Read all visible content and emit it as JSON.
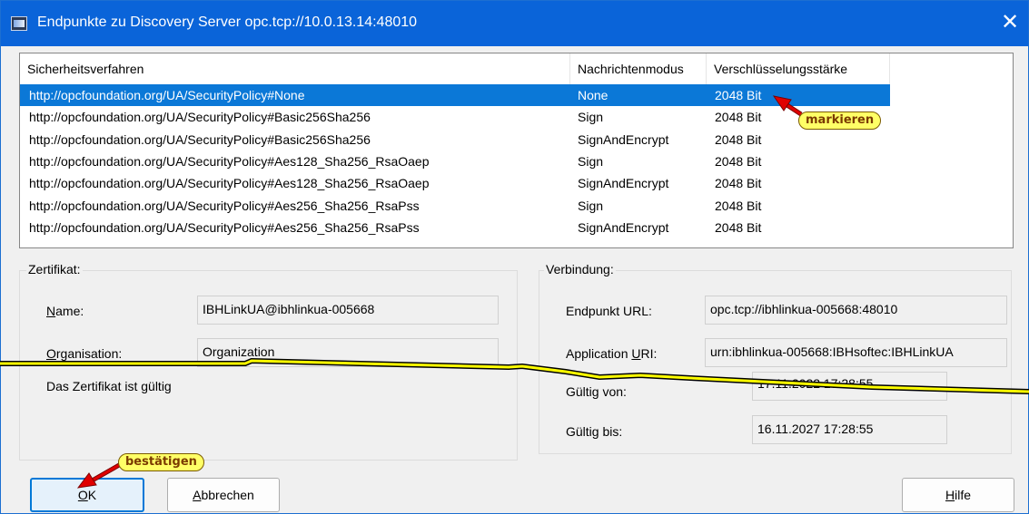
{
  "window": {
    "title": "Endpunkte zu Discovery Server opc.tcp://10.0.13.14:48010",
    "close_symbol": "✕"
  },
  "list": {
    "headers": [
      "Sicherheitsverfahren",
      "Nachrichtenmodus",
      "Verschlüsselungsstärke"
    ],
    "rows": [
      {
        "policy": "http://opcfoundation.org/UA/SecurityPolicy#None",
        "mode": "None",
        "strength": "2048 Bit",
        "selected": true
      },
      {
        "policy": "http://opcfoundation.org/UA/SecurityPolicy#Basic256Sha256",
        "mode": "Sign",
        "strength": "2048 Bit"
      },
      {
        "policy": "http://opcfoundation.org/UA/SecurityPolicy#Basic256Sha256",
        "mode": "SignAndEncrypt",
        "strength": "2048 Bit"
      },
      {
        "policy": "http://opcfoundation.org/UA/SecurityPolicy#Aes128_Sha256_RsaOaep",
        "mode": "Sign",
        "strength": "2048 Bit"
      },
      {
        "policy": "http://opcfoundation.org/UA/SecurityPolicy#Aes128_Sha256_RsaOaep",
        "mode": "SignAndEncrypt",
        "strength": "2048 Bit"
      },
      {
        "policy": "http://opcfoundation.org/UA/SecurityPolicy#Aes256_Sha256_RsaPss",
        "mode": "Sign",
        "strength": "2048 Bit"
      },
      {
        "policy": "http://opcfoundation.org/UA/SecurityPolicy#Aes256_Sha256_RsaPss",
        "mode": "SignAndEncrypt",
        "strength": "2048 Bit"
      }
    ]
  },
  "certificate": {
    "group_label": "Zertifikat:",
    "name_label": {
      "hot": "N",
      "rest": "ame:"
    },
    "name_value": "IBHLinkUA@ibhlinkua-005668",
    "org_label": {
      "hot": "O",
      "rest": "rganisation:"
    },
    "org_value": "Organization",
    "status": "Das Zertifikat ist gültig"
  },
  "connection": {
    "group_label": "Verbindung:",
    "endpoint_label": "Endpunkt URL:",
    "endpoint_value": "opc.tcp://ibhlinkua-005668:48010",
    "app_uri_label": {
      "pre": "Application ",
      "hot": "U",
      "rest": "RI:"
    },
    "app_uri_value": "urn:ibhlinkua-005668:IBHsoftec:IBHLinkUA",
    "valid_from_label": "Gültig von:",
    "valid_from_value": "17.11.2022 17:28:55",
    "valid_to_label": "Gültig bis:",
    "valid_to_value": "16.11.2027 17:28:55"
  },
  "buttons": {
    "ok": {
      "hot": "O",
      "rest": "K"
    },
    "cancel": {
      "hot": "A",
      "rest": "bbrechen"
    },
    "help": {
      "hot": "H",
      "rest": "ilfe"
    }
  },
  "annotations": {
    "mark": "markieren",
    "confirm": "bestätigen",
    "callout_color": "#ffff66",
    "arrow_color": "#e00000",
    "tear_line_color": "#ffff00"
  },
  "colors": {
    "titlebar": "#0a64d9",
    "selection": "#0b78d7"
  }
}
